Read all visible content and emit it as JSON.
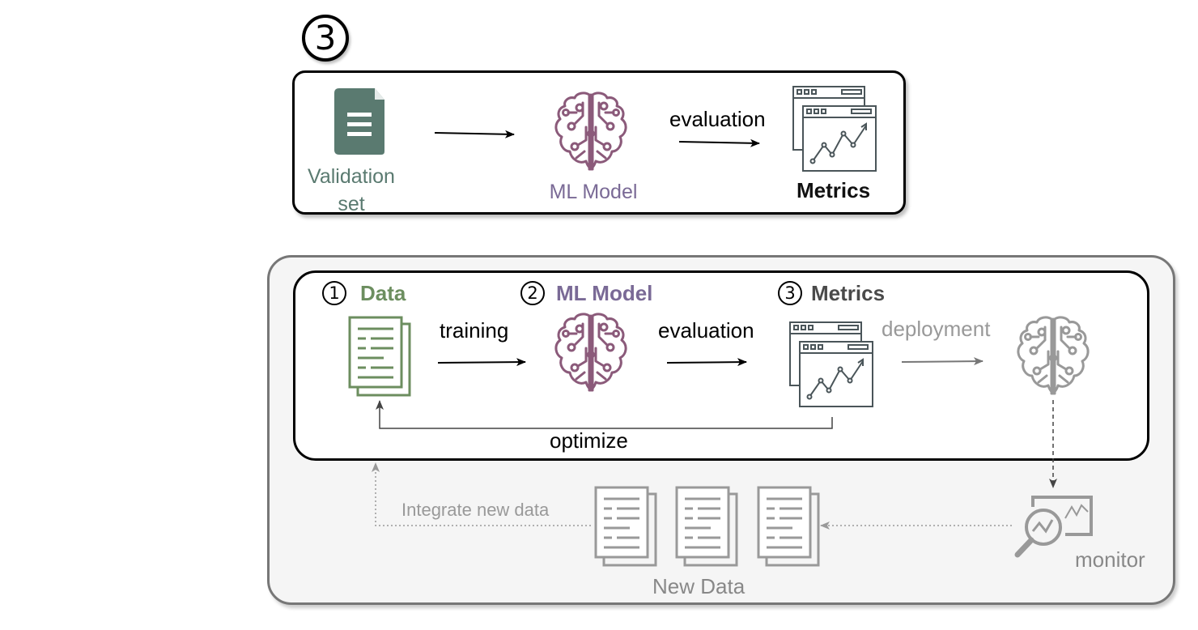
{
  "top_panel": {
    "step_number": "3",
    "validation_label_line1": "Validation",
    "validation_label_line2": "set",
    "model_label": "ML Model",
    "edge_label": "evaluation",
    "metrics_label": "Metrics"
  },
  "pipeline": {
    "steps": [
      {
        "number": "1",
        "label": "Data"
      },
      {
        "number": "2",
        "label": "ML Model"
      },
      {
        "number": "3",
        "label": "Metrics"
      }
    ],
    "training_label": "training",
    "evaluation_label": "evaluation",
    "deployment_label": "deployment",
    "optimize_label": "optimize",
    "integrate_label": "Integrate new data",
    "new_data_label": "New Data",
    "monitor_label": "monitor"
  },
  "colors": {
    "data_green": "#6c8e5f",
    "validation_teal": "#5a7a70",
    "model_purple": "#8b5a7a",
    "model_label_purple": "#7a6a96",
    "metrics_gray": "#4a5559",
    "inactive_gray": "#999999"
  },
  "icons": [
    "document-icon",
    "documents-icon",
    "brain-circuit-icon",
    "metrics-dashboard-icon",
    "monitor-magnifier-icon"
  ]
}
